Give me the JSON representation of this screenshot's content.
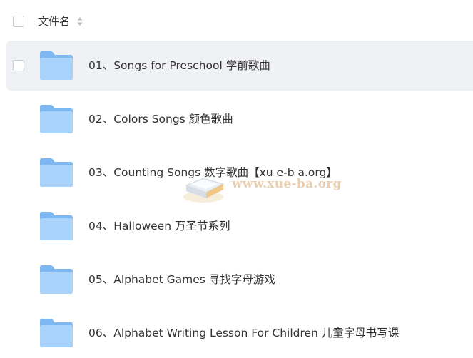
{
  "header": {
    "column_label": "文件名",
    "select_all_checked": false
  },
  "files": [
    {
      "name": "01、Songs for Preschool 学前歌曲",
      "type": "folder",
      "hover": true
    },
    {
      "name": "02、Colors Songs 颜色歌曲",
      "type": "folder",
      "hover": false
    },
    {
      "name": "03、Counting Songs 数字歌曲【xu e-b a.org】",
      "type": "folder",
      "hover": false
    },
    {
      "name": "04、Halloween 万圣节系列",
      "type": "folder",
      "hover": false
    },
    {
      "name": "05、Alphabet Games 寻找字母游戏",
      "type": "folder",
      "hover": false
    },
    {
      "name": "06、Alphabet Writing Lesson For Children 儿童字母书写课",
      "type": "folder",
      "hover": false
    }
  ],
  "watermark": {
    "text": "www.xue-ba.org"
  },
  "colors": {
    "folder_back": "#7eb8f2",
    "folder_front": "#a9d3fb",
    "hover_row": "#f0f1f4",
    "watermark": "#e8c9a6"
  }
}
